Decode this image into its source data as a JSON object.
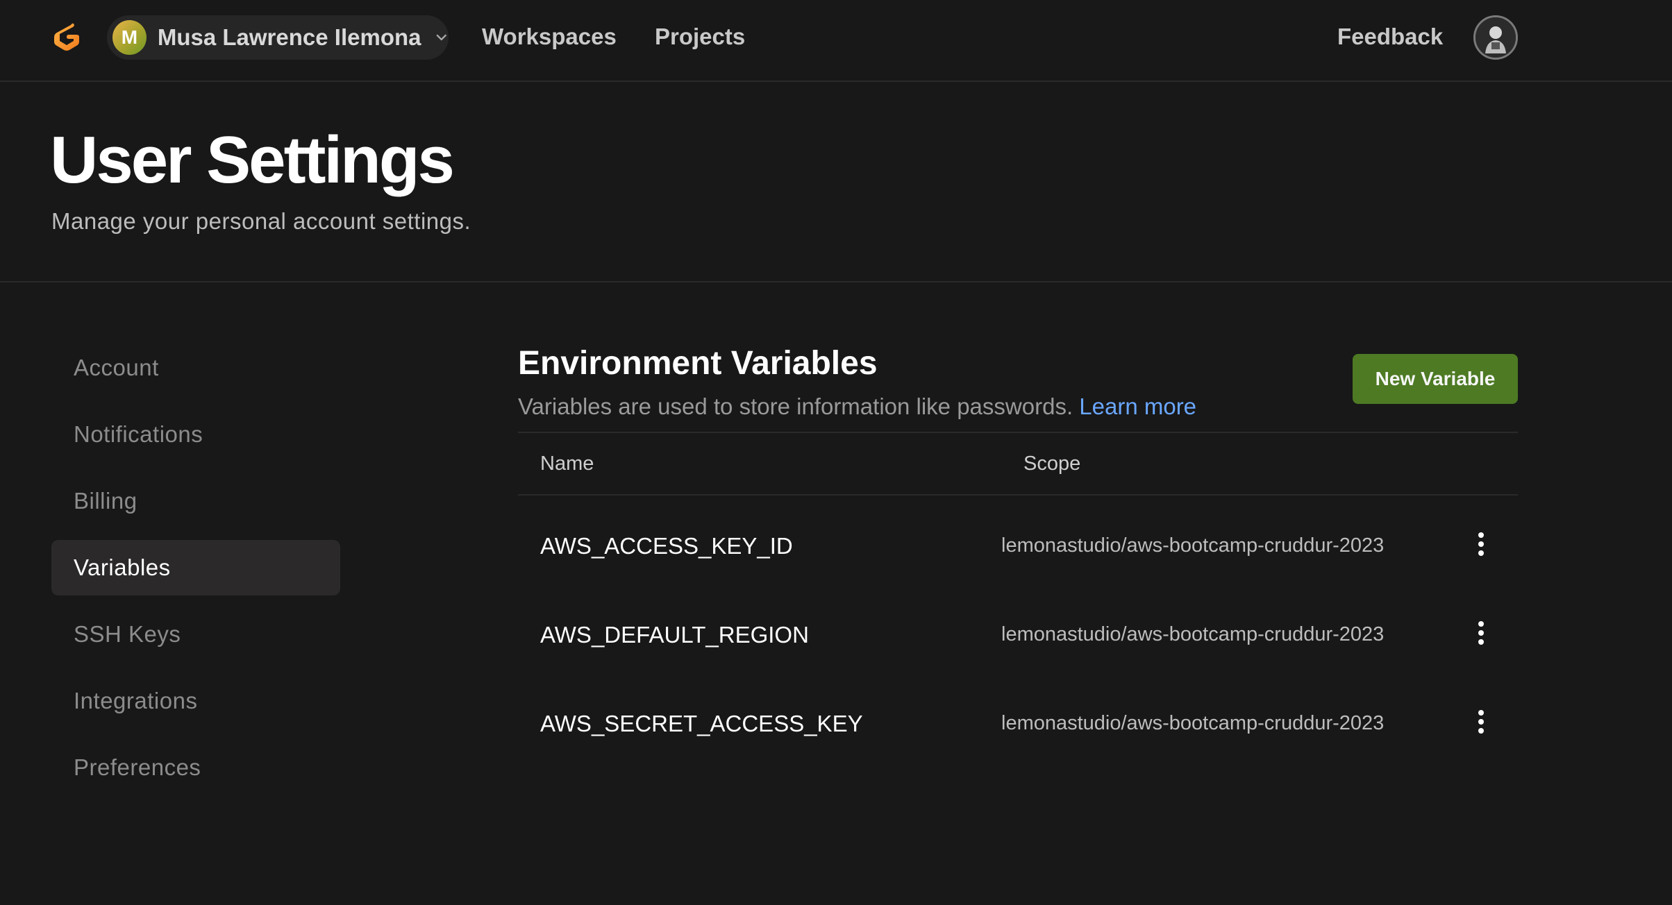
{
  "app": {
    "logo": "gitpod-logo-icon"
  },
  "topbar": {
    "user": {
      "initial": "M",
      "name": "Musa Lawrence Ilemona"
    },
    "nav": {
      "workspaces": "Workspaces",
      "projects": "Projects",
      "feedback": "Feedback"
    }
  },
  "header": {
    "title": "User Settings",
    "subtitle": "Manage your personal account settings."
  },
  "sidebar": {
    "items": [
      {
        "label": "Account"
      },
      {
        "label": "Notifications"
      },
      {
        "label": "Billing"
      },
      {
        "label": "Variables",
        "active": true
      },
      {
        "label": "SSH Keys"
      },
      {
        "label": "Integrations"
      },
      {
        "label": "Preferences"
      }
    ]
  },
  "main": {
    "title": "Environment Variables",
    "description": "Variables are used to store information like passwords.",
    "learn_more": "Learn more",
    "new_button": "New Variable",
    "table": {
      "headers": {
        "name": "Name",
        "scope": "Scope"
      },
      "rows": [
        {
          "name": "AWS_ACCESS_KEY_ID",
          "scope": "lemonastudio/aws-bootcamp-cruddur-2023"
        },
        {
          "name": "AWS_DEFAULT_REGION",
          "scope": "lemonastudio/aws-bootcamp-cruddur-2023"
        },
        {
          "name": "AWS_SECRET_ACCESS_KEY",
          "scope": "lemonastudio/aws-bootcamp-cruddur-2023"
        }
      ]
    }
  },
  "colors": {
    "background": "#181818",
    "accent_button": "#4d7a23",
    "link": "#6aa7ff",
    "logo_orange": "#f59a2e"
  }
}
